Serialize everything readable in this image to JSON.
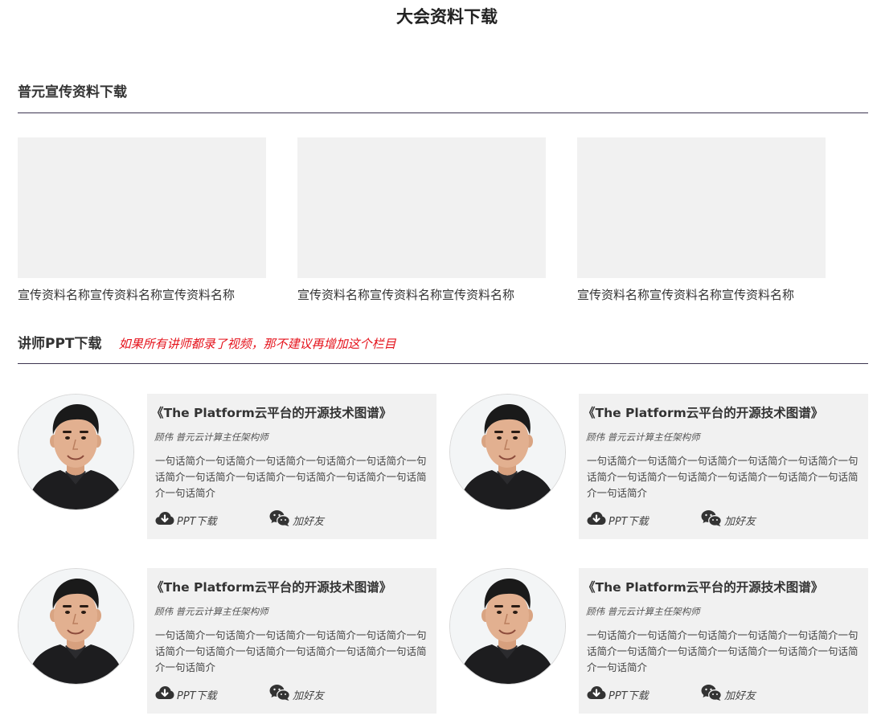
{
  "page": {
    "title": "大会资料下载"
  },
  "promo": {
    "heading": "普元宣传资料下载",
    "items": [
      {
        "name": "宣传资料名称宣传资料名称宣传资料名称"
      },
      {
        "name": "宣传资料名称宣传资料名称宣传资料名称"
      },
      {
        "name": "宣传资料名称宣传资料名称宣传资料名称"
      }
    ]
  },
  "ppt": {
    "heading": "讲师PPT下载",
    "note": "如果所有讲师都录了视频，那不建议再增加这个栏目",
    "speakers": [
      {
        "talk_title": "《The Platform云平台的开源技术图谱》",
        "meta": "顾伟  普元云计算主任架构师",
        "bio": "一句话简介一句话简介一句话简介一句话简介一句话简介一句话简介一句话简介一句话简介一句话简介一句话简介一句话简介一句话简介",
        "download_label": "PPT下载",
        "add_friend_label": "加好友"
      },
      {
        "talk_title": "《The Platform云平台的开源技术图谱》",
        "meta": "顾伟  普元云计算主任架构师",
        "bio": "一句话简介一句话简介一句话简介一句话简介一句话简介一句话简介一句话简介一句话简介一句话简介一句话简介一句话简介一句话简介",
        "download_label": "PPT下载",
        "add_friend_label": "加好友"
      },
      {
        "talk_title": "《The Platform云平台的开源技术图谱》",
        "meta": "顾伟  普元云计算主任架构师",
        "bio": "一句话简介一句话简介一句话简介一句话简介一句话简介一句话简介一句话简介一句话简介一句话简介一句话简介一句话简介一句话简介",
        "download_label": "PPT下载",
        "add_friend_label": "加好友"
      },
      {
        "talk_title": "《The Platform云平台的开源技术图谱》",
        "meta": "顾伟  普元云计算主任架构师",
        "bio": "一句话简介一句话简介一句话简介一句话简介一句话简介一句话简介一句话简介一句话简介一句话简介一句话简介一句话简介一句话简介",
        "download_label": "PPT下载",
        "add_friend_label": "加好友"
      }
    ]
  },
  "icons": {
    "download": "cloud-download-icon",
    "add_friend": "wechat-icon"
  },
  "colors": {
    "note": "#e5121b",
    "divider": "#3d3550",
    "panel": "#f1f1f1"
  }
}
